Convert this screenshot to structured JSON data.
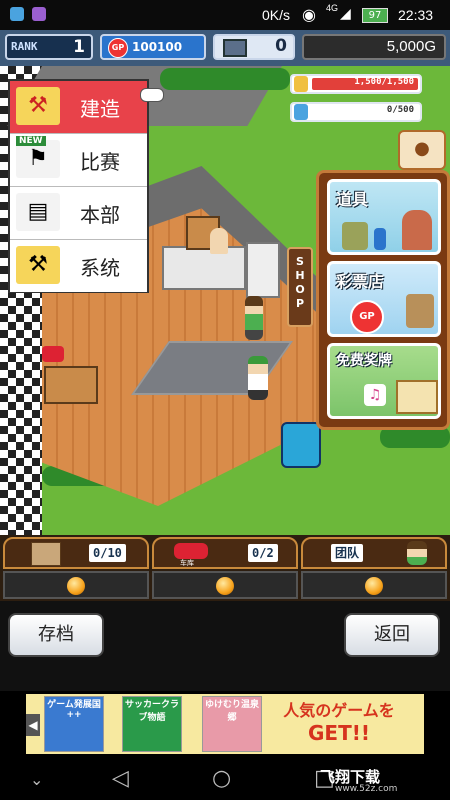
{
  "status_bar": {
    "speed": "0K/s",
    "network": "4G",
    "battery": "97",
    "time": "22:33"
  },
  "header": {
    "rank_label": "RANK",
    "rank_value": "1",
    "gp_icon_text": "GP",
    "gp_value": "100100",
    "pc_value": "0",
    "money_value": "5,000G"
  },
  "resources": {
    "bar1_text": "1,500/1,500",
    "bar1_fill": 1.0,
    "bar2_text": "0/500",
    "bar2_fill": 0.0
  },
  "menu": {
    "items": [
      {
        "label": "建造",
        "icon": "crane-icon",
        "active": true
      },
      {
        "label": "比赛",
        "icon": "checkered-flag-icon",
        "badge": "NEW"
      },
      {
        "label": "本部",
        "icon": "document-icon"
      },
      {
        "label": "系统",
        "icon": "wrench-hammer-icon"
      }
    ]
  },
  "shop": {
    "tab_label": "SHOP",
    "cards": [
      {
        "label": "道具",
        "color": "#8fd0e8"
      },
      {
        "label": "彩票店",
        "color": "#9fd3f0"
      },
      {
        "label": "免费奖牌",
        "color": "#7cc46a"
      }
    ]
  },
  "status_cards": [
    {
      "counter": "0/10",
      "icon": "box-icon"
    },
    {
      "counter": "0/2",
      "icon": "car-icon",
      "icon_label": "车库"
    },
    {
      "label": "团队",
      "icon": "player-icon"
    }
  ],
  "buttons": {
    "save": "存档",
    "back": "返回"
  },
  "ad": {
    "tile1": "ゲーム発展国++",
    "tile2": "サッカークラブ物語",
    "tile3": "ゆけむり温泉郷",
    "promo_line1": "人気のゲームを",
    "promo_line2": "GET!!"
  },
  "watermark": {
    "name": "飞翔下载",
    "url": "www.52z.com"
  }
}
